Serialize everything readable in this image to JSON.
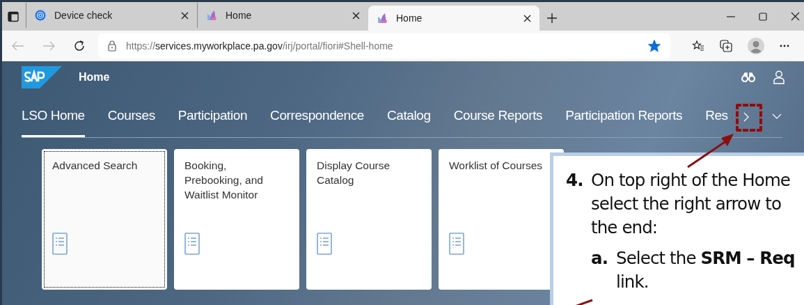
{
  "browser": {
    "tabs": [
      {
        "title": "Device check",
        "selected": false,
        "kind": "globe"
      },
      {
        "title": "Home",
        "selected": false,
        "kind": "sap"
      },
      {
        "title": "Home",
        "selected": true,
        "kind": "sap"
      }
    ],
    "url": {
      "scheme": "https://",
      "host": "services.myworkplace.pa.gov",
      "path": "/irj/portal/fiori#Shell-home"
    },
    "favorite": true
  },
  "shell": {
    "title": "Home",
    "nav": [
      {
        "label": "LSO Home",
        "selected": true
      },
      {
        "label": "Courses",
        "selected": false
      },
      {
        "label": "Participation",
        "selected": false
      },
      {
        "label": "Correspondence",
        "selected": false
      },
      {
        "label": "Catalog",
        "selected": false
      },
      {
        "label": "Course Reports",
        "selected": false
      },
      {
        "label": "Participation Reports",
        "selected": false
      },
      {
        "label": "Res",
        "selected": false
      }
    ],
    "tiles": [
      {
        "title": "Advanced Search",
        "focused": true
      },
      {
        "title": "Booking, Prebooking, and Waitlist Monitor",
        "focused": false
      },
      {
        "title": "Display Course Catalog",
        "focused": false
      },
      {
        "title": "Worklist of Courses",
        "focused": false
      }
    ]
  },
  "callout": {
    "step": "4.",
    "lines": [
      "On top right of the Home",
      "select the right arrow to",
      "the end:"
    ],
    "substep": {
      "marker": "a.",
      "lines": [
        "Select the **SRM – Req**",
        "link."
      ]
    }
  }
}
